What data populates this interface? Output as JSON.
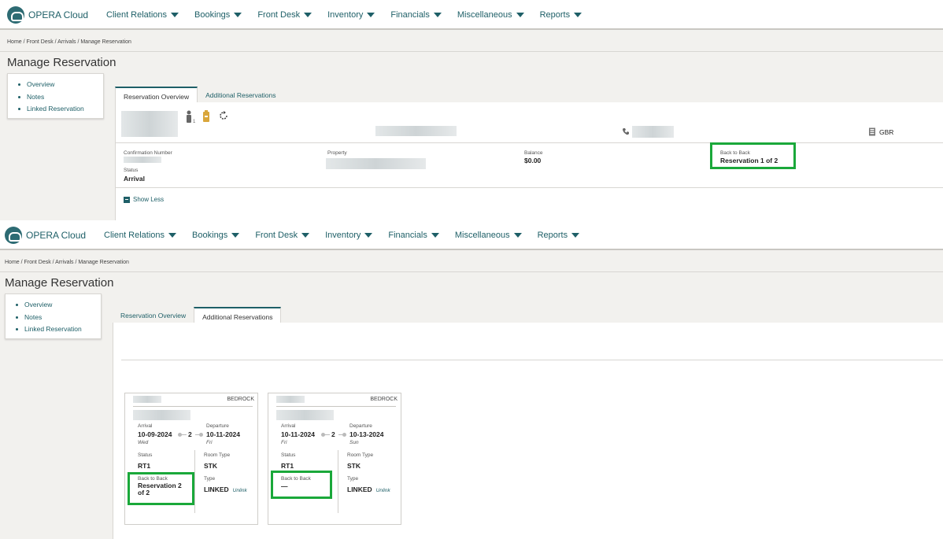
{
  "app": {
    "name": "OPERA Cloud"
  },
  "nav": [
    "Client Relations",
    "Bookings",
    "Front Desk",
    "Inventory",
    "Financials",
    "Miscellaneous",
    "Reports"
  ],
  "breadcrumb": "Home / Front Desk / Arrivals / Manage Reservation",
  "page_title": "Manage Reservation",
  "sidenav": [
    "Overview",
    "Notes",
    "Linked Reservation"
  ],
  "tabs": [
    "Reservation Overview",
    "Additional Reservations"
  ],
  "overview": {
    "country": "GBR",
    "confirmation_label": "Confirmation Number",
    "property_label": "Property",
    "balance_label": "Balance",
    "balance_value": "$0.00",
    "back_label": "Back to Back",
    "back_value": "Reservation 1 of 2",
    "status_label": "Status",
    "status_value": "Arrival",
    "show_less": "Show Less",
    "adults_count": "1"
  },
  "cards": [
    {
      "property": "BEDROCK",
      "arrival_label": "Arrival",
      "arrival": "10-09-2024",
      "arrival_day": "Wed",
      "nights": "2",
      "departure_label": "Departure",
      "departure": "10-11-2024",
      "departure_day": "Fri",
      "status_label": "Status",
      "status": "RT1",
      "room_type_label": "Room Type",
      "room_type": "STK",
      "back_label": "Back to Back",
      "back_value": "Reservation 2 of 2",
      "type_label": "Type",
      "type": "LINKED",
      "unlink": "Unlink"
    },
    {
      "property": "BEDROCK",
      "arrival_label": "Arrival",
      "arrival": "10-11-2024",
      "arrival_day": "Fri",
      "nights": "2",
      "departure_label": "Departure",
      "departure": "10-13-2024",
      "departure_day": "Sun",
      "status_label": "Status",
      "status": "RT1",
      "room_type_label": "Room Type",
      "room_type": "STK",
      "back_label": "Back to Back",
      "back_value": "—",
      "type_label": "Type",
      "type": "LINKED",
      "unlink": "Unlink"
    }
  ],
  "colors": {
    "accent": "#1e5f67",
    "highlight": "#1aa83a"
  }
}
